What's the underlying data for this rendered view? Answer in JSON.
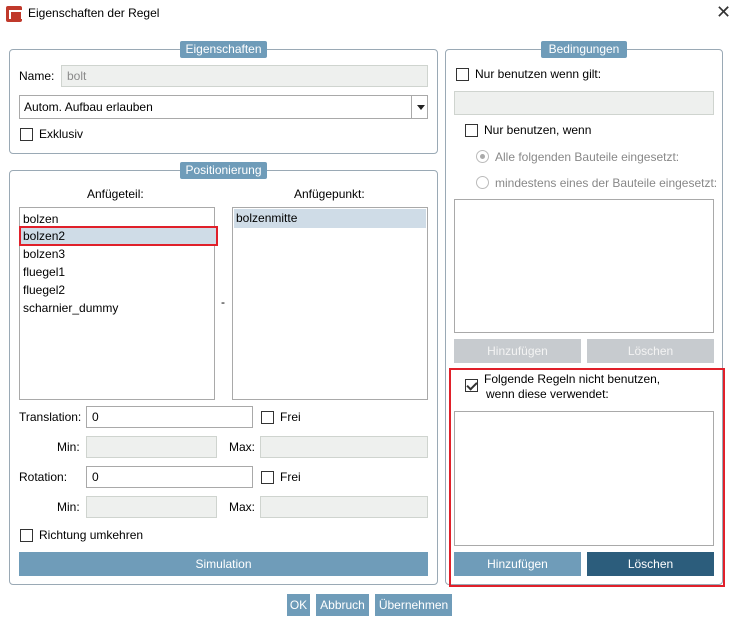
{
  "window": {
    "title": "Eigenschaften der Regel",
    "close_glyph": "✕"
  },
  "eigenschaften": {
    "legend": "Eigenschaften",
    "name_label": "Name:",
    "name_value": "bolt",
    "dropdown_value": "Autom. Aufbau erlauben",
    "exklusiv_label": "Exklusiv"
  },
  "positionierung": {
    "legend": "Positionierung",
    "anfuegeteil_header": "Anfügeteil:",
    "anfuegepunkt_header": "Anfügepunkt:",
    "anfuegeteil_items": [
      "bolzen",
      "bolzen2",
      "bolzen3",
      "fluegel1",
      "fluegel2",
      "scharnier_dummy"
    ],
    "anfuegeteil_selected": "bolzen2",
    "anfuegepunkt_items": [
      "bolzenmitte"
    ],
    "separator": "-",
    "translation_label": "Translation:",
    "translation_value": "0",
    "rotation_label": "Rotation:",
    "rotation_value": "0",
    "frei_label": "Frei",
    "min_label": "Min:",
    "max_label": "Max:",
    "richtung_label": "Richtung umkehren",
    "simulation_button": "Simulation"
  },
  "bedingungen": {
    "legend": "Bedingungen",
    "nur_wenn_gilt": "Nur benutzen wenn gilt:",
    "nur_wenn": "Nur benutzen, wenn",
    "radio_alle": "Alle folgenden Bauteile eingesetzt:",
    "radio_mindestens": "mindestens eines der Bauteile eingesetzt:",
    "hinzufuegen": "Hinzufügen",
    "loeschen": "Löschen",
    "folgende_line1": "Folgende Regeln nicht benutzen,",
    "folgende_line2": "wenn diese verwendet:",
    "hinzufuegen2": "Hinzufügen",
    "loeschen2": "Löschen"
  },
  "footer": {
    "ok": "OK",
    "abbruch": "Abbruch",
    "uebernehmen": "Übernehmen"
  },
  "colors": {
    "accent": "#6f9cb9",
    "accent_dark": "#2c5d7c",
    "highlight": "#e0202a"
  }
}
